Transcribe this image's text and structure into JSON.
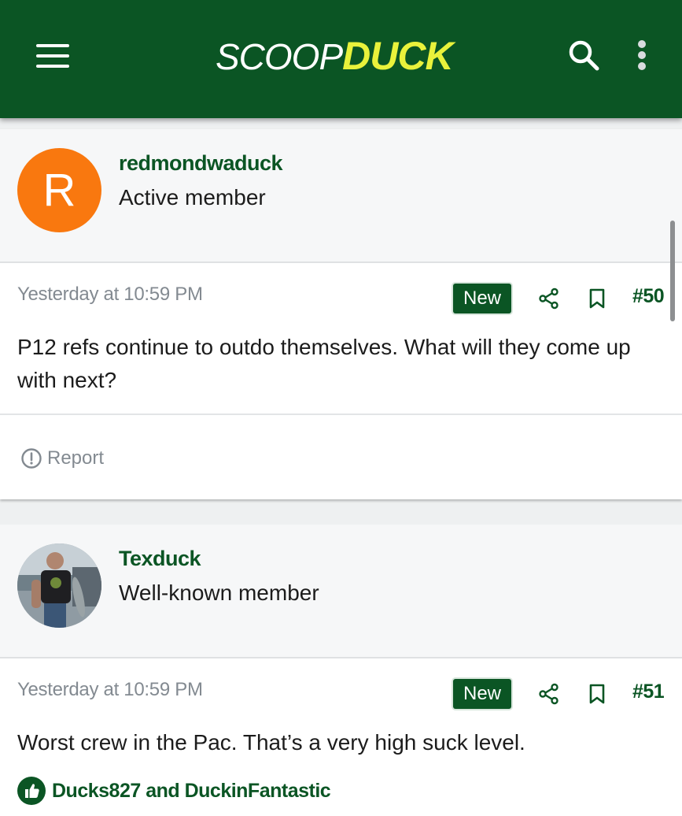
{
  "header": {
    "logo_part1": "SCOOP",
    "logo_part2": "DUCK"
  },
  "colors": {
    "brand_green": "#0b5524",
    "logo_yellow": "#e9f23b",
    "avatar_orange": "#f9780f",
    "meta_gray": "#838a91"
  },
  "posts": [
    {
      "avatar_letter": "R",
      "username": "redmondwaduck",
      "user_title": "Active member",
      "timestamp": "Yesterday at 10:59 PM",
      "badge": "New",
      "post_number": "#50",
      "body": "P12 refs continue to outdo themselves. What will they come up with next?",
      "report_label": "Report"
    },
    {
      "username": "Texduck",
      "user_title": "Well-known member",
      "timestamp": "Yesterday at 10:59 PM",
      "badge": "New",
      "post_number": "#51",
      "body": "Worst crew in the Pac. That’s a very high suck level.",
      "reactions_text": "Ducks827 and DuckinFantastic"
    }
  ],
  "icons": {
    "menu": "hamburger-icon",
    "search": "search-icon",
    "more": "more-vertical-icon",
    "share": "share-icon",
    "bookmark": "bookmark-icon",
    "report": "alert-circle-icon",
    "like": "thumbs-up-icon"
  }
}
